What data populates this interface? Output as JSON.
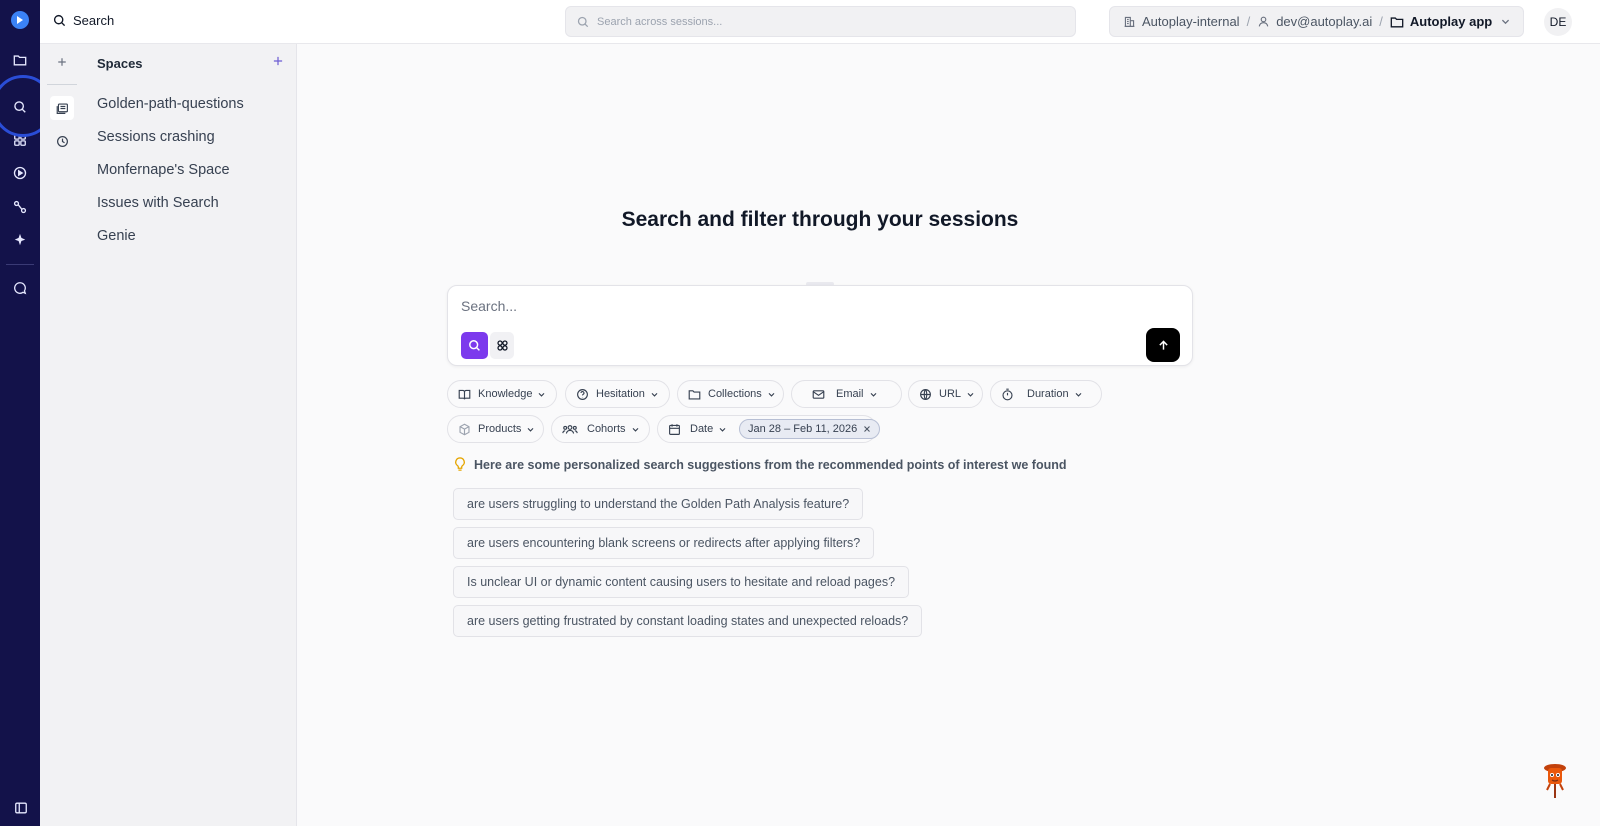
{
  "topbar": {
    "title": "Search",
    "search_placeholder": "Search across sessions...",
    "org": "Autoplay-internal",
    "user": "dev@autoplay.ai",
    "app": "Autoplay app",
    "separator": "/",
    "avatar_initials": "DE"
  },
  "rail": {
    "items": [
      "folder-icon",
      "search-icon",
      "dashboard-icon",
      "play-circle-icon",
      "flow-icon",
      "sparkle-icon",
      "chat-icon"
    ],
    "active": "search-icon",
    "colors": {
      "background": "#13124a",
      "highlight_ring": "#2a4dd6"
    }
  },
  "spaces": {
    "heading": "Spaces",
    "items": [
      "Golden-path-questions",
      "Sessions crashing",
      "Monfernape's Space",
      "Issues with Search",
      "Genie"
    ]
  },
  "main": {
    "headline": "Search and filter through your sessions",
    "search_placeholder": "Search...",
    "filters": [
      {
        "label": "Knowledge",
        "icon": "book-icon"
      },
      {
        "label": "Hesitation",
        "icon": "question-icon"
      },
      {
        "label": "Collections",
        "icon": "folder-icon"
      },
      {
        "label": "Email",
        "icon": "mail-icon"
      },
      {
        "label": "URL",
        "icon": "globe-icon"
      },
      {
        "label": "Duration",
        "icon": "timer-icon"
      },
      {
        "label": "Products",
        "icon": "box-icon"
      },
      {
        "label": "Cohorts",
        "icon": "users-icon"
      },
      {
        "label": "Date",
        "icon": "calendar-icon"
      }
    ],
    "date_range": "Jan 28 – Feb 11, 2026",
    "hint": "Here are some personalized search suggestions from the recommended points of interest we found",
    "suggestions": [
      "are users struggling to understand the Golden Path Analysis feature?",
      "are users encountering blank screens or redirects after applying filters?",
      "Is unclear UI or dynamic content causing users to hesitate and reload pages?",
      "are users getting frustrated by constant loading states and unexpected reloads?"
    ],
    "colors": {
      "accent": "#7c3aed",
      "send": "#000000"
    }
  }
}
